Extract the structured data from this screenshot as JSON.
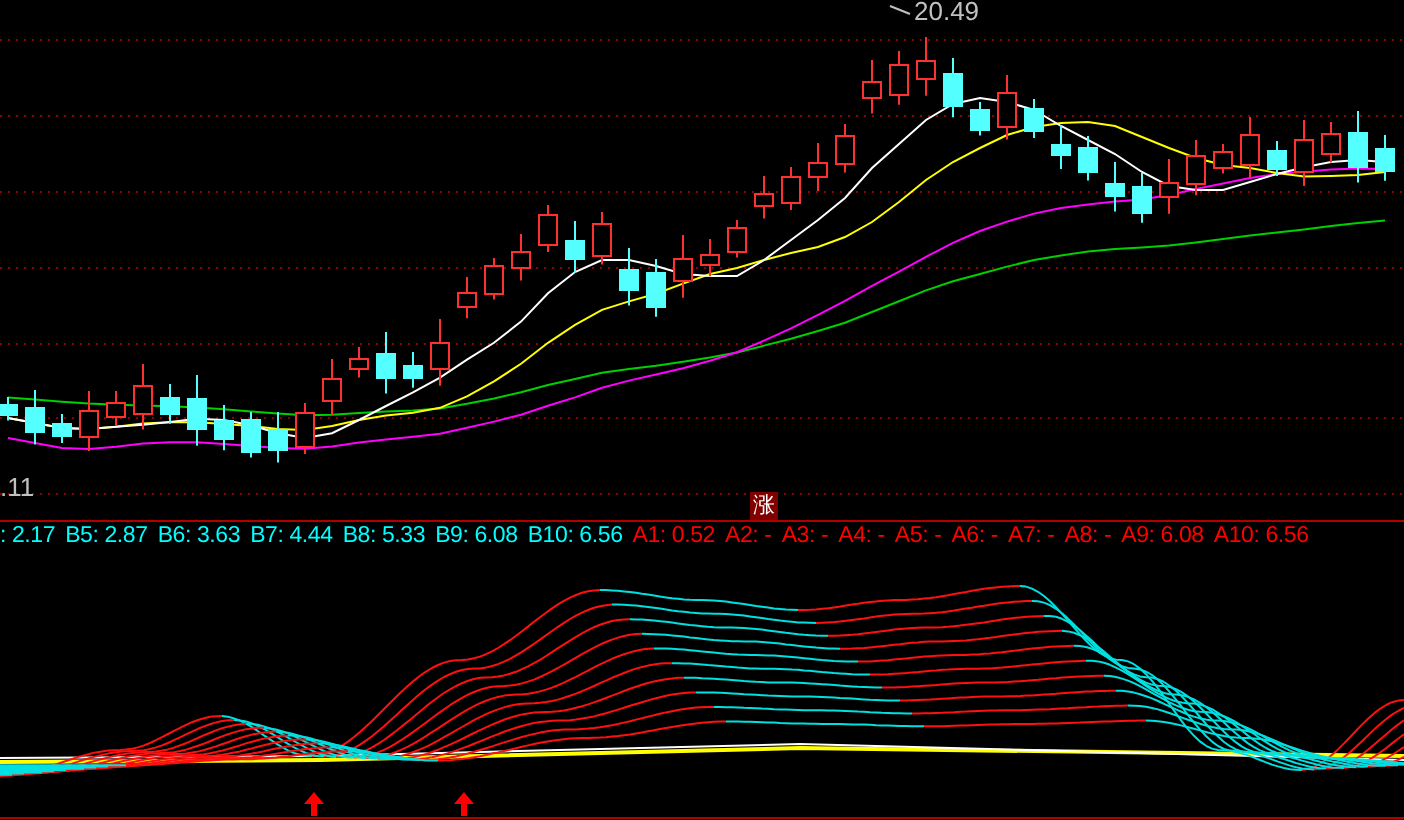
{
  "price_chart": {
    "high_label": "20.49",
    "low_label": ".11",
    "badge": "涨"
  },
  "indicator_legend": [
    {
      "text": ": 2.17",
      "color": "#00ffff"
    },
    {
      "text": "B5: 2.87",
      "color": "#00ffff"
    },
    {
      "text": "B6: 3.63",
      "color": "#00ffff"
    },
    {
      "text": "B7: 4.44",
      "color": "#00ffff"
    },
    {
      "text": "B8: 5.33",
      "color": "#00ffff"
    },
    {
      "text": "B9: 6.08",
      "color": "#00ffff"
    },
    {
      "text": "B10: 6.56",
      "color": "#00ffff"
    },
    {
      "text": "A1: 0.52",
      "color": "#ff0000"
    },
    {
      "text": "A2: -",
      "color": "#ff0000"
    },
    {
      "text": "A3: -",
      "color": "#ff0000"
    },
    {
      "text": "A4: -",
      "color": "#ff0000"
    },
    {
      "text": "A5: -",
      "color": "#ff0000"
    },
    {
      "text": "A6: -",
      "color": "#ff0000"
    },
    {
      "text": "A7: -",
      "color": "#ff0000"
    },
    {
      "text": "A8: -",
      "color": "#ff0000"
    },
    {
      "text": "A9: 6.08",
      "color": "#ff0000"
    },
    {
      "text": "A10: 6.56",
      "color": "#ff0000"
    }
  ]
}
